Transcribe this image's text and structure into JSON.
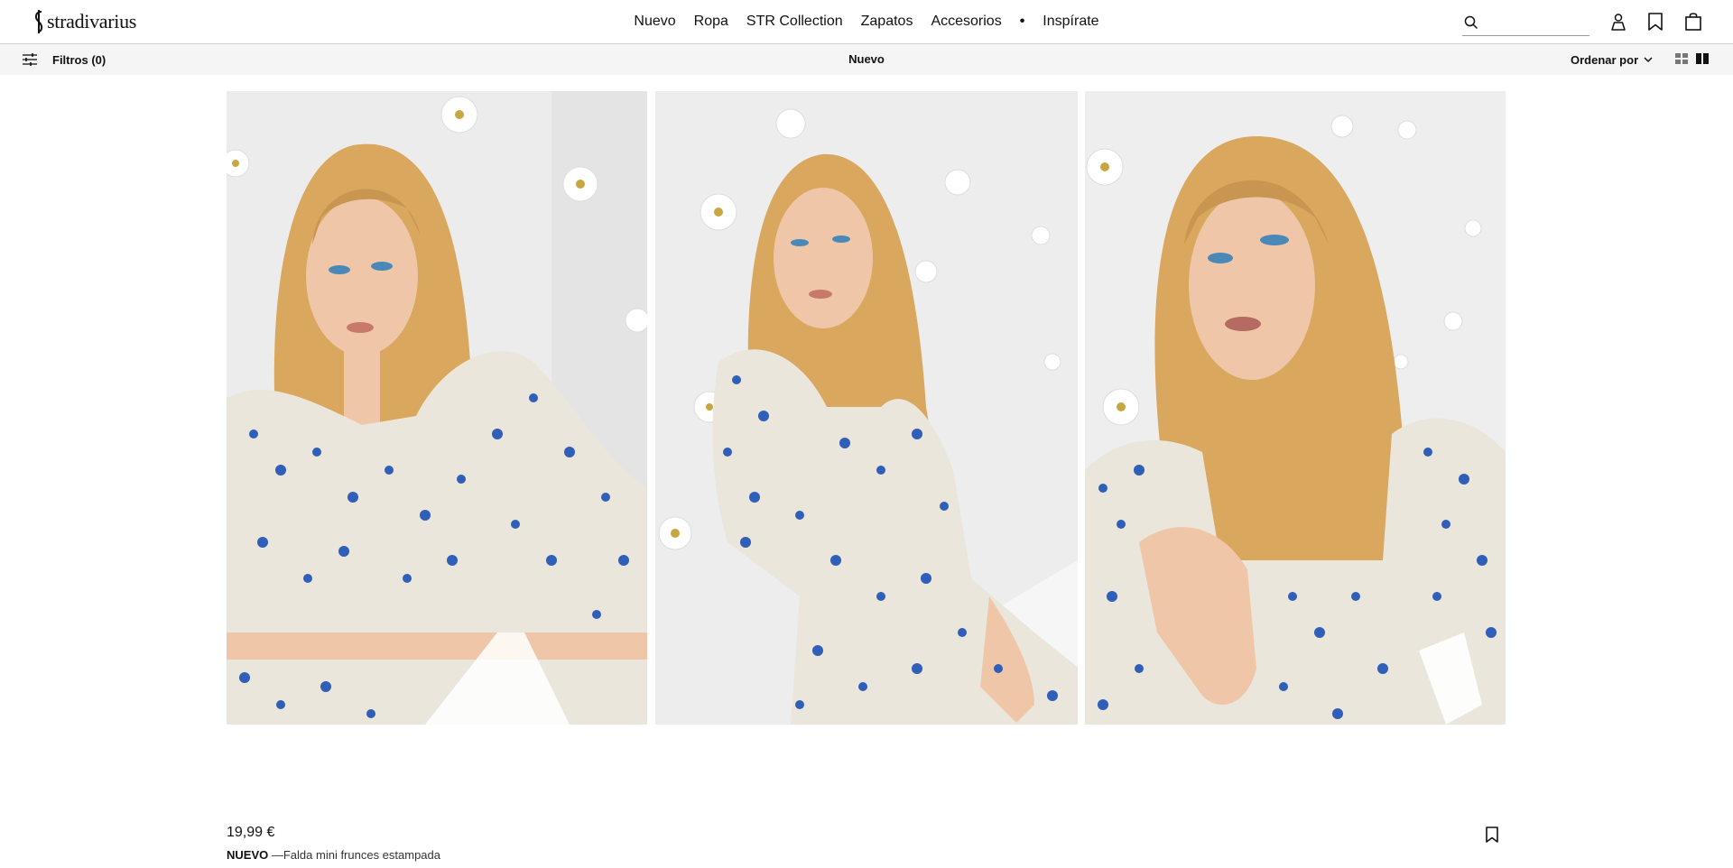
{
  "header": {
    "logo_text": "stradivarius",
    "nav": [
      "Nuevo",
      "Ropa",
      "STR Collection",
      "Zapatos",
      "Accesorios"
    ],
    "nav_separator": "•",
    "nav_last": "Inspírate",
    "search": {
      "placeholder": "",
      "value": ""
    },
    "icons": [
      "search-icon",
      "user-icon",
      "bookmark-icon",
      "shopping-bag-icon"
    ]
  },
  "subbar": {
    "filters_label": "Filtros (0)",
    "title": "Nuevo",
    "sort_label": "Ordenar por",
    "view_modes": [
      "grid-view-icon",
      "two-column-view-icon"
    ],
    "active_view": "two-column-view-icon"
  },
  "product": {
    "price": "19,99 €",
    "tag": "NUEVO",
    "name": "—Falda mini frunces estampada",
    "images": [
      "front-portrait",
      "side-seated",
      "close-up-portrait"
    ]
  },
  "colors": {
    "header_border": "#cfcfcf",
    "subbar_bg": "#f5f5f5",
    "text": "#111111",
    "print_blue": "#2f5fb8",
    "fabric": "#ebe6dc",
    "hair": "#d9a85e",
    "skin": "#efc7a8",
    "wall": "#efefef"
  }
}
